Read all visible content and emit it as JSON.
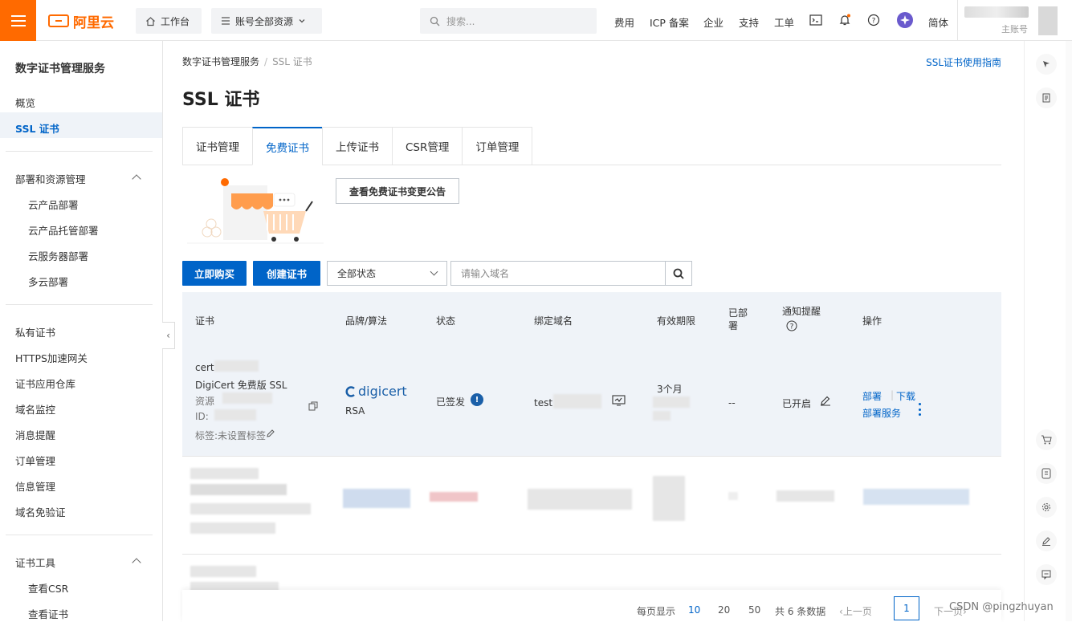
{
  "topbar": {
    "brand": "阿里云",
    "workbench": "工作台",
    "resources": "账号全部资源",
    "search_placeholder": "搜索...",
    "nav": [
      "费用",
      "ICP 备案",
      "企业",
      "支持",
      "工单"
    ],
    "lang": "简体",
    "account_type": "主账号"
  },
  "sidebar": {
    "title": "数字证书管理服务",
    "items": [
      "概览",
      "SSL 证书"
    ],
    "group1": {
      "label": "部署和资源管理",
      "children": [
        "云产品部署",
        "云产品托管部署",
        "云服务器部署",
        "多云部署"
      ]
    },
    "items2": [
      "私有证书",
      "HTTPS加速网关",
      "证书应用仓库",
      "域名监控",
      "消息提醒",
      "订单管理",
      "信息管理",
      "域名免验证"
    ],
    "group2": {
      "label": "证书工具",
      "children": [
        "查看CSR",
        "查看证书"
      ]
    }
  },
  "breadcrumb": {
    "root": "数字证书管理服务",
    "current": "SSL 证书"
  },
  "guide_link": "SSL证书使用指南",
  "page_title": "SSL 证书",
  "tabs": [
    "证书管理",
    "免费证书",
    "上传证书",
    "CSR管理",
    "订单管理"
  ],
  "notice_button": "查看免费证书变更公告",
  "actions": {
    "buy": "立即购买",
    "create": "创建证书"
  },
  "filter": {
    "status": "全部状态",
    "domain_placeholder": "请输入域名"
  },
  "table": {
    "headers": [
      "证书",
      "品牌/算法",
      "状态",
      "绑定域名",
      "有效期限",
      "已部署",
      "通知提醒",
      "操作"
    ],
    "row1": {
      "cert_prefix": "cert",
      "cert_type": "DigiCert 免费版 SSL",
      "resource_prefix": "资源",
      "id_prefix": "ID:",
      "tag": "标签:未设置标签",
      "brand": "digicert",
      "algo": "RSA",
      "status": "已签发",
      "domain_prefix": "test",
      "validity": "3个月",
      "deployed": "--",
      "notify": "已开启",
      "ops": [
        "部署",
        "下载",
        "部署服务"
      ]
    }
  },
  "pager": {
    "per_page_label": "每页显示",
    "sizes": [
      "10",
      "20",
      "50"
    ],
    "total": "共 6 条数据",
    "prev": "上一页",
    "page": "1",
    "next": "下一页"
  },
  "watermark": "CSDN @pingzhuyan",
  "colors": {
    "brand": "#ff6a00",
    "primary": "#0064c8",
    "row_bg": "#eff3f8"
  }
}
